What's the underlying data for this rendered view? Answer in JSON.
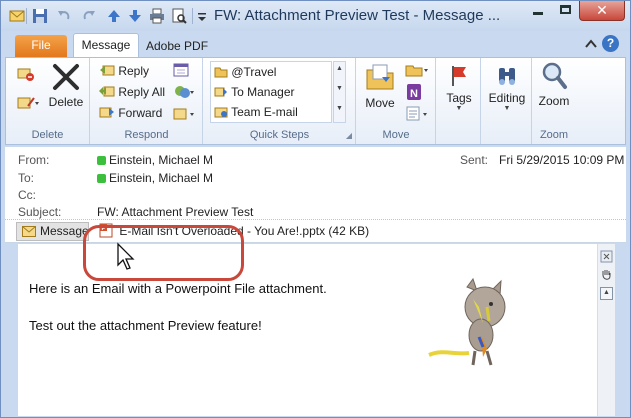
{
  "window": {
    "title": "FW: Attachment Preview Test  -  Message ..."
  },
  "tabs": {
    "file": "File",
    "message": "Message",
    "adobe": "Adobe PDF",
    "help": "?"
  },
  "ribbon": {
    "delete_group": {
      "delete": "Delete",
      "label": "Delete"
    },
    "respond_group": {
      "reply": "Reply",
      "reply_all": "Reply All",
      "forward": "Forward",
      "label": "Respond"
    },
    "quick_steps": {
      "items": [
        "@Travel",
        "To Manager",
        "Team E-mail"
      ],
      "label": "Quick Steps"
    },
    "move_group": {
      "move": "Move",
      "label": "Move"
    },
    "tags": {
      "label_btn": "Tags"
    },
    "editing": {
      "label_btn": "Editing"
    },
    "zoom_group": {
      "zoom": "Zoom",
      "label": "Zoom"
    }
  },
  "header": {
    "from_label": "From:",
    "from": "Einstein, Michael M",
    "to_label": "To:",
    "to": "Einstein, Michael M",
    "cc_label": "Cc:",
    "subject_label": "Subject:",
    "subject": "FW: Attachment Preview Test",
    "sent_label": "Sent:",
    "sent": "Fri 5/29/2015 10:09 PM"
  },
  "attachments": {
    "message_tab": "Message",
    "file": "E-Mail Isn't Overloaded - You Are!.pptx (42 KB)"
  },
  "body": {
    "line1": "Here is an Email with a Powerpoint File attachment.",
    "line2": "Test out the attachment Preview feature!"
  }
}
